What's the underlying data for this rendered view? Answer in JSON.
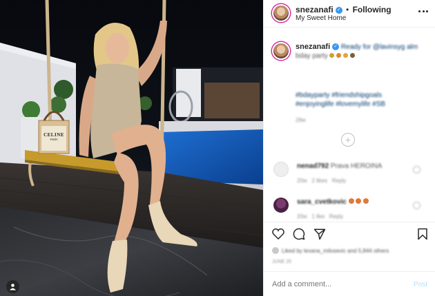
{
  "header": {
    "username": "snezanafi",
    "follow_separator": "•",
    "follow_label": "Following",
    "location": "My Sweet Home",
    "more_icon": "more-horizontal-icon"
  },
  "caption": {
    "username": "snezanafi",
    "text_line1": "Ready for @lavinsyg alm",
    "text_line2": "bday party",
    "hashtags_line1": "#bdayparty #friendshipgoals",
    "hashtags_line2": "#enjoyinglife #lovemylife #SB",
    "time": "28w"
  },
  "comments": [
    {
      "username": "nenad792",
      "text": "Prava HEROINA",
      "time": "20w",
      "likes": "2 likes",
      "reply": "Reply"
    },
    {
      "username": "sara_cvetkovic",
      "text": "",
      "time": "20w",
      "likes": "1 like",
      "reply": "Reply"
    }
  ],
  "actions": {
    "like_icon": "heart-icon",
    "comment_icon": "comment-icon",
    "share_icon": "share-icon",
    "save_icon": "bookmark-icon"
  },
  "likes_text": "Liked by lexana_milosevic and 5,844 others",
  "post_date": "June 25",
  "add_comment": {
    "placeholder": "Add a comment...",
    "post_label": "Post"
  },
  "photo": {
    "bag_brand": "CELINE",
    "bag_sub": "PARIS"
  },
  "colors": {
    "accent": "#3897f0",
    "text": "#262626",
    "muted": "#8e8e8e",
    "border": "#efefef"
  }
}
